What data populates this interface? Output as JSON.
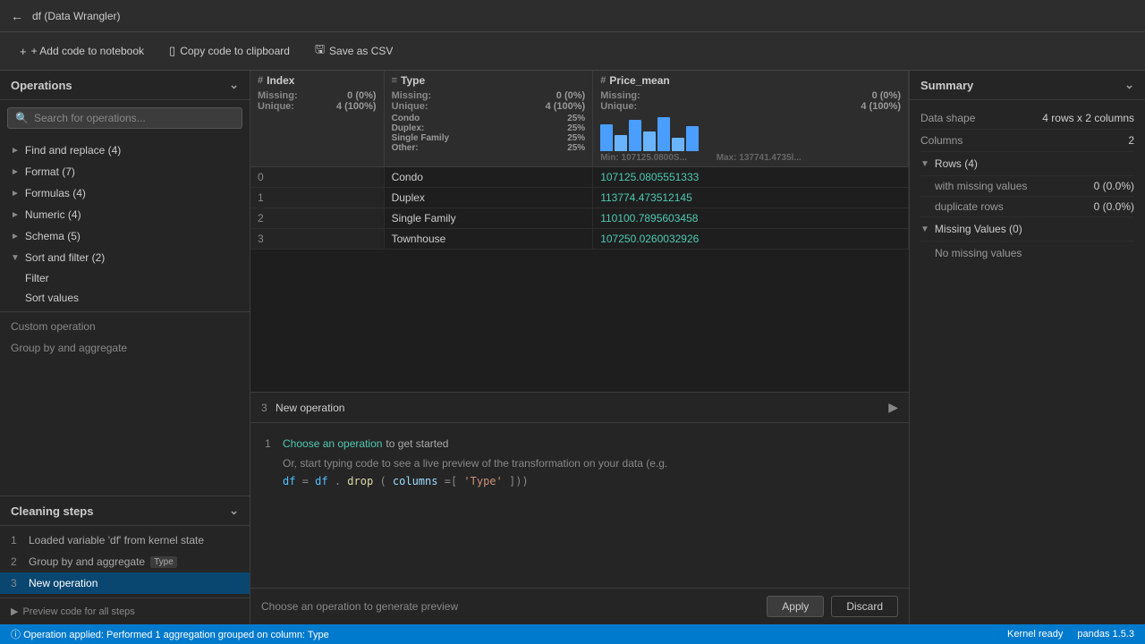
{
  "titleBar": {
    "backIcon": "←",
    "title": "df (Data Wrangler)"
  },
  "toolbar": {
    "addCode": "+ Add code to notebook",
    "copyCode": "Copy code to clipboard",
    "saveCSV": "Save as CSV"
  },
  "operations": {
    "title": "Operations",
    "searchPlaceholder": "Search for operations...",
    "groups": [
      {
        "label": "Find and replace (4)",
        "expanded": false,
        "count": 4
      },
      {
        "label": "Format (7)",
        "expanded": false,
        "count": 7
      },
      {
        "label": "Formulas (4)",
        "expanded": false,
        "count": 4
      },
      {
        "label": "Numeric (4)",
        "expanded": false,
        "count": 4
      },
      {
        "label": "Schema (5)",
        "expanded": false,
        "count": 5
      },
      {
        "label": "Sort and filter (2)",
        "expanded": true,
        "count": 2
      }
    ],
    "sortFilterItems": [
      "Filter",
      "Sort values"
    ],
    "customOperation": "Custom operation",
    "groupByAggregate": "Group by and aggregate"
  },
  "cleaningSteps": {
    "title": "Cleaning steps",
    "steps": [
      {
        "num": "1",
        "label": "Loaded variable 'df' from kernel state",
        "active": false
      },
      {
        "num": "2",
        "label": "Group by and aggregate",
        "tag": "Type",
        "active": false
      },
      {
        "num": "3",
        "label": "New operation",
        "active": true
      }
    ],
    "previewCode": "Preview code for all steps"
  },
  "dataTable": {
    "columns": [
      {
        "id": "index",
        "icon": "#",
        "name": "Index",
        "missing": "0 (0%)",
        "unique": "4 (100%)",
        "type": "index"
      },
      {
        "id": "type",
        "icon": "≡",
        "name": "Type",
        "missing": "0 (0%)",
        "unique": "4 (100%)",
        "categories": [
          {
            "name": "Condo",
            "pct": "25%"
          },
          {
            "name": "Duplex",
            "pct": "25%"
          },
          {
            "name": "Single Family",
            "pct": "25%"
          },
          {
            "name": "Other:",
            "pct": "25%"
          }
        ],
        "type": "categorical"
      },
      {
        "id": "price_mean",
        "icon": "#",
        "name": "Price_mean",
        "missing": "0 (0%)",
        "unique": "4 (100%)",
        "min": "Min: 107125.0800S...",
        "max": "Max: 137741.4735l...",
        "bars": [
          60,
          35,
          70,
          45,
          80,
          30,
          55
        ],
        "type": "numeric"
      }
    ],
    "rows": [
      {
        "index": "0",
        "type": "Condo",
        "price": "107125.0805551333"
      },
      {
        "index": "1",
        "type": "Duplex",
        "price": "113774.473512145"
      },
      {
        "index": "2",
        "type": "Single Family",
        "price": "110100.7895603458"
      },
      {
        "index": "3",
        "type": "Townhouse",
        "price": "107250.0260032926"
      }
    ]
  },
  "operationPanel": {
    "stepNum": "3",
    "title": "New operation",
    "hint1_num": "1",
    "hint1_link": "Choose an operation",
    "hint1_text": "to get started",
    "hint2": "Or, start typing code to see a live preview of the transformation on your data (e.g.",
    "codeExample": "df = df.drop(columns=['Type']))",
    "statusText": "Choose an operation to generate preview",
    "applyLabel": "Apply",
    "discardLabel": "Discard"
  },
  "summary": {
    "title": "Summary",
    "dataShape": {
      "label": "Data shape",
      "value": "4 rows x 2 columns"
    },
    "columns": {
      "label": "Columns",
      "value": "2"
    },
    "rows": {
      "label": "Rows (4)",
      "withMissingLabel": "with missing values",
      "withMissingValue": "0 (0.0%)",
      "duplicateLabel": "duplicate rows",
      "duplicateValue": "0 (0.0%)"
    },
    "missingValues": {
      "label": "Missing Values (0)",
      "noMissing": "No missing values"
    }
  },
  "statusBar": {
    "message": "Operation applied: Performed 1 aggregation grouped on column: Type",
    "kernelStatus": "Kernel ready",
    "pandasVersion": "pandas 1.5.3"
  }
}
